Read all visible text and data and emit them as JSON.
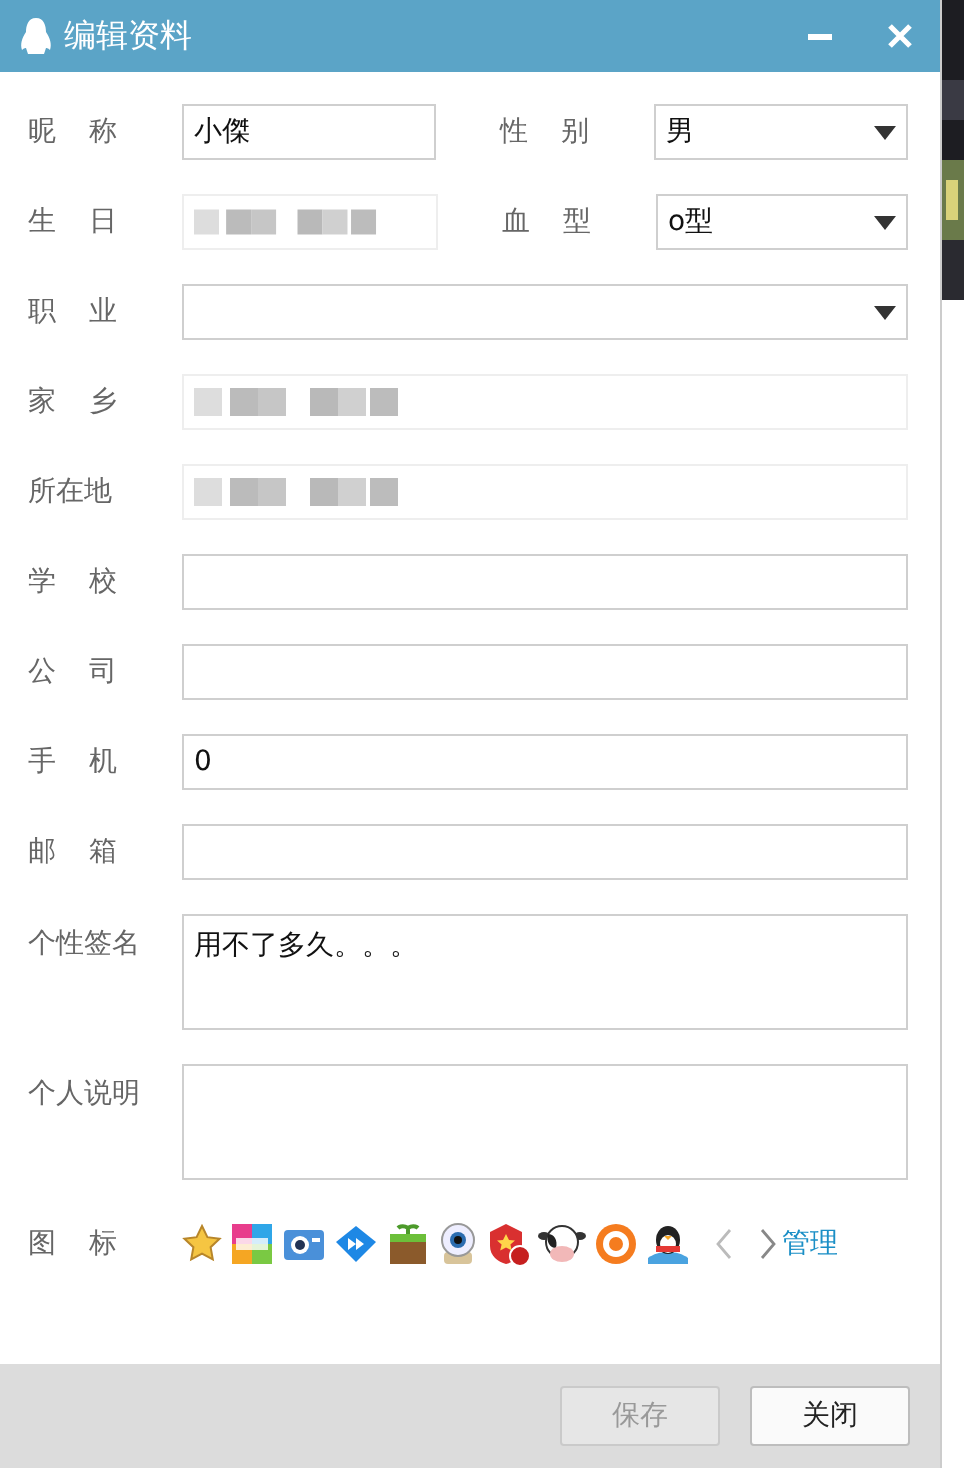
{
  "window": {
    "title": "编辑资料"
  },
  "rows": [
    {
      "items": [
        {
          "label": "昵 称",
          "kind": "text",
          "value": "小傑"
        },
        {
          "label": "性 别",
          "kind": "select",
          "value": "男"
        }
      ]
    },
    {
      "items": [
        {
          "label": "生 日",
          "kind": "blurred"
        },
        {
          "label": "血 型",
          "kind": "select",
          "value": "o型"
        }
      ]
    },
    {
      "items": [
        {
          "label": "职 业",
          "kind": "select"
        }
      ]
    },
    {
      "items": [
        {
          "label": "家 乡",
          "kind": "blurred"
        }
      ]
    },
    {
      "items": [
        {
          "label": "所在地",
          "kind": "blurred"
        }
      ]
    },
    {
      "items": [
        {
          "label": "学 校",
          "kind": "text"
        }
      ]
    },
    {
      "items": [
        {
          "label": "公 司",
          "kind": "text"
        }
      ]
    },
    {
      "items": [
        {
          "label": "手 机",
          "kind": "text",
          "value": "0"
        }
      ]
    },
    {
      "items": [
        {
          "label": "邮 箱",
          "kind": "text"
        }
      ]
    },
    {
      "items": [
        {
          "label": "个性签名",
          "kind": "textarea",
          "value": "用不了多久。。。"
        }
      ]
    },
    {
      "items": [
        {
          "label": "个人说明",
          "kind": "textarea"
        }
      ]
    }
  ],
  "icons_row": {
    "label": "图 标",
    "link": "管理"
  },
  "buttons": [
    {
      "label": "保存",
      "disabled": true
    },
    {
      "label": "关闭",
      "disabled": false
    }
  ]
}
